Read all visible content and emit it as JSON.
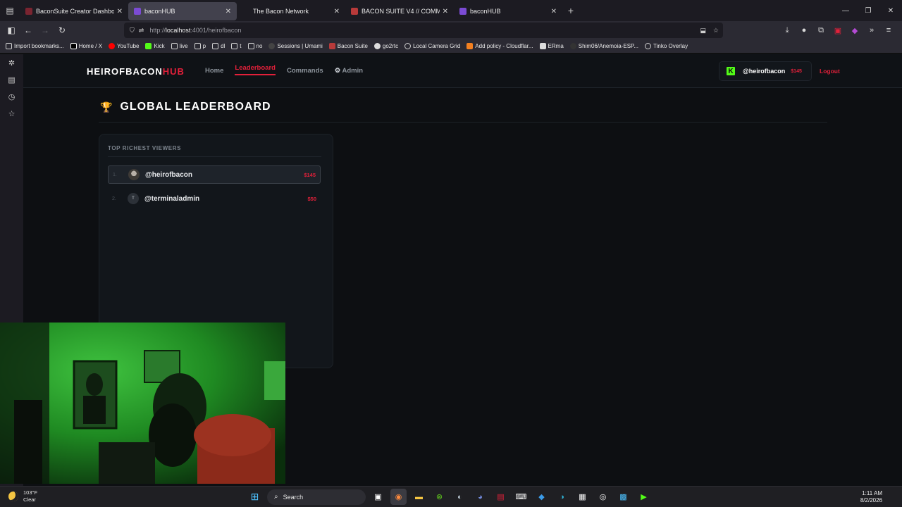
{
  "browser": {
    "tabs": [
      {
        "title": "BaconSuite Creator Dashboard",
        "active": false,
        "fav": "#7a2430"
      },
      {
        "title": "baconHUB",
        "active": true,
        "fav": "#7b4bd4"
      },
      {
        "title": "The Bacon Network",
        "active": false,
        "fav": "#3a3a3a"
      },
      {
        "title": "BACON SUITE V4 // COMMAND",
        "active": false,
        "fav": "#b83a3a"
      },
      {
        "title": "baconHUB",
        "active": false,
        "fav": "#7b4bd4"
      }
    ],
    "url_prefix": "http://",
    "url_host": "localhost",
    "url_rest": ":4001/heirofbacon",
    "bookmarks": [
      {
        "label": "Import bookmarks...",
        "color": "#cfcfcf"
      },
      {
        "label": "Home / X",
        "color": "#ffffff"
      },
      {
        "label": "YouTube",
        "color": "#ff0000"
      },
      {
        "label": "Kick",
        "color": "#53fc18"
      },
      {
        "label": "live",
        "color": "#cfcfcf"
      },
      {
        "label": "p",
        "color": "#cfcfcf"
      },
      {
        "label": "dl",
        "color": "#cfcfcf"
      },
      {
        "label": "t",
        "color": "#cfcfcf"
      },
      {
        "label": "no",
        "color": "#cfcfcf"
      },
      {
        "label": "Sessions | Umami",
        "color": "#444444"
      },
      {
        "label": "Bacon Suite",
        "color": "#b83a3a"
      },
      {
        "label": "go2rtc",
        "color": "#dddddd"
      },
      {
        "label": "Local Camera Grid",
        "color": "#cfcfcf"
      },
      {
        "label": "Add policy - Cloudflar...",
        "color": "#f38020"
      },
      {
        "label": "ERma",
        "color": "#dddddd"
      },
      {
        "label": "Shim06/Anemoia-ESP...",
        "color": "#333333"
      },
      {
        "label": "Tinko Overlay",
        "color": "#cfcfcf"
      }
    ]
  },
  "site": {
    "logo_main": "HEIROFBACON",
    "logo_hub": "HUB",
    "nav": {
      "home": "Home",
      "leaderboard": "Leaderboard",
      "commands": "Commands",
      "admin": "Admin"
    },
    "user": {
      "name": "@heirofbacon",
      "balance": "$145"
    },
    "logout": "Logout"
  },
  "leaderboard": {
    "title": "GLOBAL LEADERBOARD",
    "card_header": "TOP RICHEST VIEWERS",
    "rows": [
      {
        "rank": "1.",
        "avatar": "",
        "name": "@heirofbacon",
        "value": "$145"
      },
      {
        "rank": "2.",
        "avatar": "T",
        "name": "@terminaladmin",
        "value": "$50"
      }
    ]
  },
  "taskbar": {
    "weather_temp": "103°F",
    "weather_desc": "Clear",
    "search": "Search",
    "time": "1:11 AM",
    "date": "8/2/2026"
  }
}
